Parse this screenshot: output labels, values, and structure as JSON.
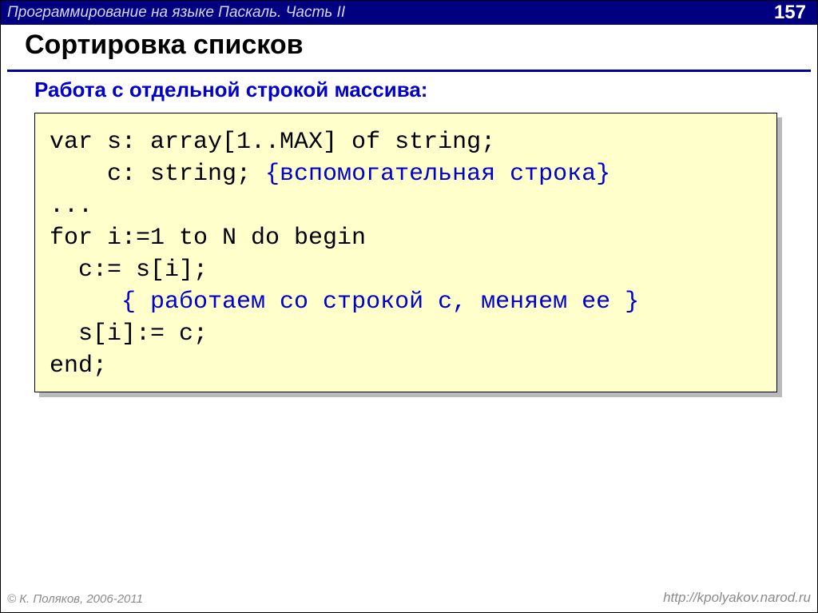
{
  "header": {
    "title": "Программирование на языке Паскаль. Часть II",
    "page": "157"
  },
  "heading": "Сортировка списков",
  "subheading": "Работа с отдельной строкой массива:",
  "code": {
    "l1a": "var s: array[1..MAX] of string;",
    "l2a": "    c: string; ",
    "l2b": "{вспомогательная строка}",
    "l3": "...",
    "l4": "for i:=1 to N do begin",
    "l5": "  c:= s[i];",
    "l6a": "     ",
    "l6b": "{ работаем со строкой c, меняем ее }",
    "l7": "  s[i]:= c;",
    "l8": "end;"
  },
  "footer": {
    "copyright": "© К. Поляков, 2006-2011",
    "url": "http://kpolyakov.narod.ru"
  }
}
